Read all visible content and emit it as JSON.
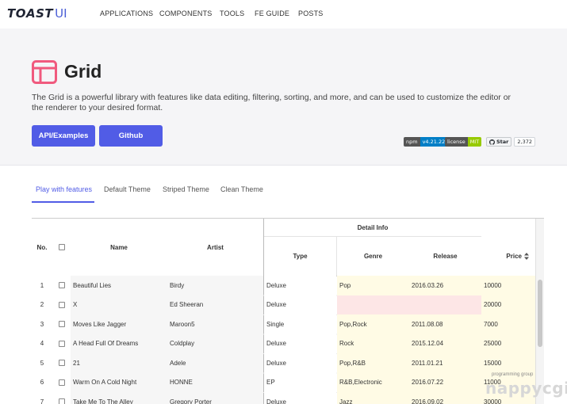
{
  "nav": {
    "logo_toast": "TOAST",
    "logo_ui": "UI",
    "links": [
      "APPLICATIONS",
      "COMPONENTS",
      "TOOLS",
      "FE GUIDE",
      "POSTS"
    ]
  },
  "hero": {
    "title": "Grid",
    "description": "The Grid is a powerful library with features like data editing, filtering, sorting, and more, and can be used to customize the editor or the renderer to your desired format.",
    "buttons": [
      "API/Examples",
      "Github"
    ],
    "badges": {
      "npm_label": "npm",
      "npm_value": "v4.21.22",
      "license_label": "license",
      "license_value": "MIT",
      "star_label": "Star",
      "star_count": "2,372"
    },
    "accent": "#515ce6",
    "icon_color": "#f05a7e"
  },
  "tabs": [
    "Play with features",
    "Default Theme",
    "Striped Theme",
    "Clean Theme"
  ],
  "grid": {
    "group_header": "Detail Info",
    "columns": {
      "no": "No.",
      "name": "Name",
      "artist": "Artist",
      "type": "Type",
      "genre": "Genre",
      "release": "Release",
      "price": "Price"
    },
    "sort_icon": "sort-icon",
    "rows": [
      {
        "no": "1",
        "name": "Beautiful Lies",
        "artist": "Birdy",
        "type": "Deluxe",
        "genre": "Pop",
        "release": "2016.03.26",
        "price": "10000",
        "genre_invalid": false
      },
      {
        "no": "2",
        "name": "X",
        "artist": "Ed Sheeran",
        "type": "Deluxe",
        "genre": "",
        "release": "",
        "price": "20000",
        "genre_invalid": true
      },
      {
        "no": "3",
        "name": "Moves Like Jagger",
        "artist": "Maroon5",
        "type": "Single",
        "genre": "Pop,Rock",
        "release": "2011.08.08",
        "price": "7000",
        "genre_invalid": false
      },
      {
        "no": "4",
        "name": "A Head Full Of Dreams",
        "artist": "Coldplay",
        "type": "Deluxe",
        "genre": "Rock",
        "release": "2015.12.04",
        "price": "25000",
        "genre_invalid": false
      },
      {
        "no": "5",
        "name": "21",
        "artist": "Adele",
        "type": "Deluxe",
        "genre": "Pop,R&B",
        "release": "2011.01.21",
        "price": "15000",
        "genre_invalid": false
      },
      {
        "no": "6",
        "name": "Warm On A Cold Night",
        "artist": "HONNE",
        "type": "EP",
        "genre": "R&B,Electronic",
        "release": "2016.07.22",
        "price": "11000",
        "genre_invalid": false
      },
      {
        "no": "7",
        "name": "Take Me To The Alley",
        "artist": "Gregory Porter",
        "type": "Deluxe",
        "genre": "Jazz",
        "release": "2016.09.02",
        "price": "30000",
        "genre_invalid": false
      }
    ]
  },
  "watermark": {
    "small": "programming group",
    "big": "nappycgi"
  }
}
